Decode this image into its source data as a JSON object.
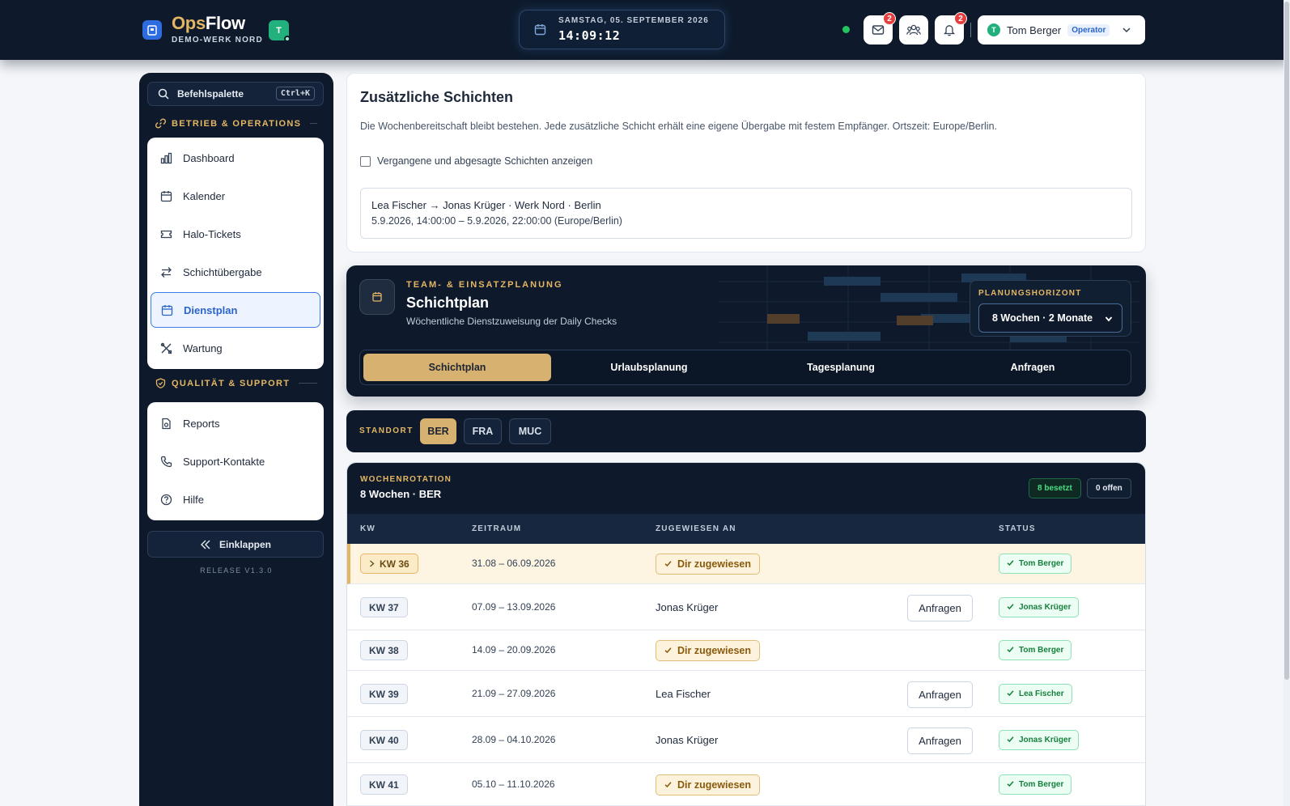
{
  "header": {
    "brand_prefix": "Ops",
    "brand_suffix": "Flow",
    "brand_subtitle": "DEMO-WERK NORD",
    "team_badge": "T",
    "clock_date": "SAMSTAG, 05. SEPTEMBER 2026",
    "clock_time": "14:09:12",
    "mail_count": "2",
    "notification_count": "2",
    "user_initial": "T",
    "user_name": "Tom Berger",
    "user_role": "Operator"
  },
  "sidebar": {
    "command_palette_label": "Befehlspalette",
    "command_palette_shortcut": "Ctrl+K",
    "section_operations": "BETRIEB & OPERATIONS",
    "section_quality": "QUALITÄT & SUPPORT",
    "operations_items": [
      {
        "label": "Dashboard",
        "icon": "chart-icon"
      },
      {
        "label": "Kalender",
        "icon": "calendar-icon"
      },
      {
        "label": "Halo-Tickets",
        "icon": "ticket-icon"
      },
      {
        "label": "Schichtübergabe",
        "icon": "swap-icon"
      },
      {
        "label": "Dienstplan",
        "icon": "calendar-icon",
        "active": true
      },
      {
        "label": "Wartung",
        "icon": "tools-icon"
      }
    ],
    "quality_items": [
      {
        "label": "Reports",
        "icon": "report-icon"
      },
      {
        "label": "Support-Kontakte",
        "icon": "phone-icon"
      },
      {
        "label": "Hilfe",
        "icon": "help-icon"
      }
    ],
    "collapse_label": "Einklappen",
    "release": "RELEASE V1.3.0"
  },
  "extra_shifts": {
    "title": "Zusätzliche Schichten",
    "description": "Die Wochenbereitschaft bleibt bestehen. Jede zusätzliche Schicht erhält eine eigene Übergabe mit festem Empfänger. Ortszeit: Europe/Berlin.",
    "checkbox_label": "Vergangene und abgesagte Schichten anzeigen",
    "checkbox_checked": false,
    "handover_title": "Lea Fischer → Jonas Krüger · Werk Nord · Berlin",
    "handover_time": "5.9.2026, 14:00:00 – 5.9.2026, 22:00:00 (Europe/Berlin)"
  },
  "planning": {
    "eyebrow": "TEAM- & EINSATZPLANUNG",
    "title": "Schichtplan",
    "subtitle": "Wöchentliche Dienstzuweisung der Daily Checks",
    "horizon_label": "PLANUNGSHORIZONT",
    "horizon_value": "8 Wochen · 2 Monate",
    "tabs": [
      "Schichtplan",
      "Urlaubsplanung",
      "Tagesplanung",
      "Anfragen"
    ],
    "active_tab": "Schichtplan"
  },
  "site": {
    "label": "STANDORT",
    "options": [
      "BER",
      "FRA",
      "MUC"
    ],
    "selected": "BER"
  },
  "rotation": {
    "eyebrow": "WOCHENROTATION",
    "title": "8 Wochen · BER",
    "filled_pill": "8 besetzt",
    "open_pill": "0 offen",
    "columns": [
      "KW",
      "ZEITRAUM",
      "ZUGEWIESEN AN",
      "STATUS"
    ],
    "mine_label": "Dir zugewiesen",
    "request_label": "Anfragen",
    "rows": [
      {
        "kw": "KW 36",
        "period": "31.08 – 06.09.2026",
        "assignee": "",
        "mine": true,
        "status": "Tom Berger",
        "current": true
      },
      {
        "kw": "KW 37",
        "period": "07.09 – 13.09.2026",
        "assignee": "Jonas Krüger",
        "mine": false,
        "status": "Jonas Krüger"
      },
      {
        "kw": "KW 38",
        "period": "14.09 – 20.09.2026",
        "assignee": "",
        "mine": true,
        "status": "Tom Berger"
      },
      {
        "kw": "KW 39",
        "period": "21.09 – 27.09.2026",
        "assignee": "Lea Fischer",
        "mine": false,
        "status": "Lea Fischer"
      },
      {
        "kw": "KW 40",
        "period": "28.09 – 04.10.2026",
        "assignee": "Jonas Krüger",
        "mine": false,
        "status": "Jonas Krüger"
      },
      {
        "kw": "KW 41",
        "period": "05.10 – 11.10.2026",
        "assignee": "",
        "mine": true,
        "status": "Tom Berger"
      }
    ]
  },
  "colors": {
    "navy": "#0e1a2c",
    "gold": "#e4b663",
    "accent_blue": "#2b64c9",
    "success_green": "#15803d"
  }
}
